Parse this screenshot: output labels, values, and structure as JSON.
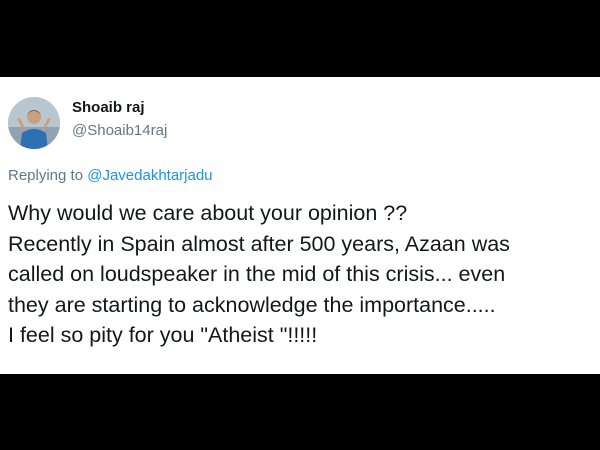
{
  "tweet": {
    "author": {
      "display_name": "Shoaib raj",
      "handle": "@Shoaib14raj"
    },
    "reply": {
      "prefix": "Replying to",
      "target": "@Javedakhtarjadu"
    },
    "text_lines": [
      "Why would we care about your opinion ??",
      "Recently in Spain almost after 500 years, Azaan was",
      "called on loudspeaker in the mid of this crisis... even",
      "they are starting to acknowledge the importance.....",
      "I feel so pity for you \"Atheist \"!!!!!"
    ]
  },
  "colors": {
    "background": "#000000",
    "card": "#ffffff",
    "text_primary": "#14171a",
    "text_secondary": "#657786",
    "link": "#1b95e0"
  }
}
